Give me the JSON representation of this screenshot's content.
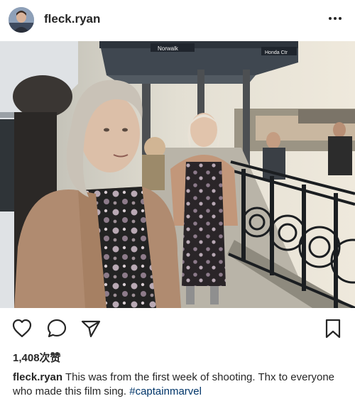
{
  "post": {
    "username": "fleck.ryan",
    "avatar_icon": "profile-avatar",
    "photo": {
      "signs": {
        "north": "Norwalk",
        "east": "Honda Ctr"
      }
    },
    "actions": {
      "like_icon": "heart-outline-icon",
      "comment_icon": "speech-bubble-icon",
      "share_icon": "paper-plane-icon",
      "save_icon": "bookmark-icon"
    },
    "likes": "1,408次赞",
    "caption": {
      "username": "fleck.ryan",
      "text": " This was from the first week of shooting. Thx to everyone who made this film sing. ",
      "hashtag": "#captainmarvel"
    }
  },
  "colors": {
    "text": "#262626",
    "hashtag": "#003569",
    "background": "#ffffff"
  }
}
